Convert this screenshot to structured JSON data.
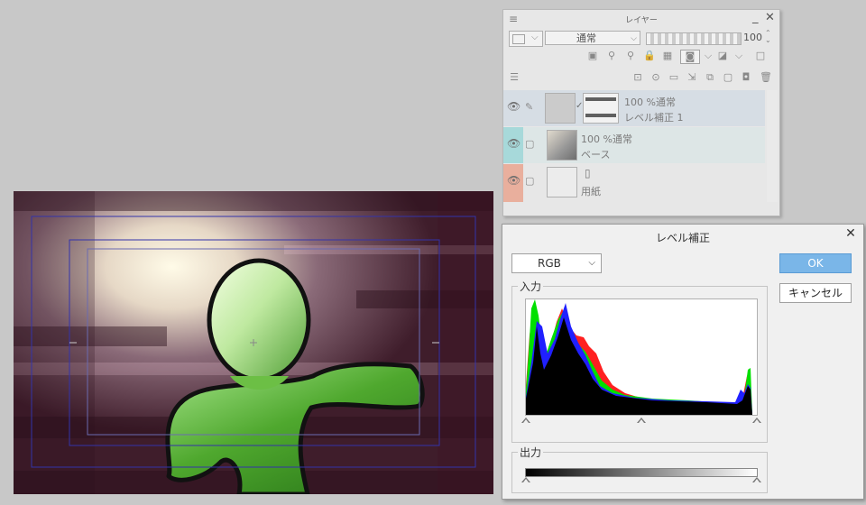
{
  "layer_panel": {
    "title": "レイヤー",
    "blend_mode": "通常",
    "opacity": "100",
    "layers": [
      {
        "line1": "100 %通常",
        "line2": "レベル補正 1"
      },
      {
        "line1": "100 %通常",
        "line2": "ベース"
      },
      {
        "line1": "",
        "line2": "用紙"
      }
    ]
  },
  "level_dialog": {
    "title": "レベル補正",
    "channel": "RGB",
    "ok_label": "OK",
    "cancel_label": "キャンセル",
    "input_label": "入力",
    "output_label": "出力"
  },
  "colors": {
    "ok_button": "#7ab6e8",
    "hist_red": "#ff2020",
    "hist_green": "#00e000",
    "hist_blue": "#2020ff",
    "figure_green": "#5fd23c"
  }
}
